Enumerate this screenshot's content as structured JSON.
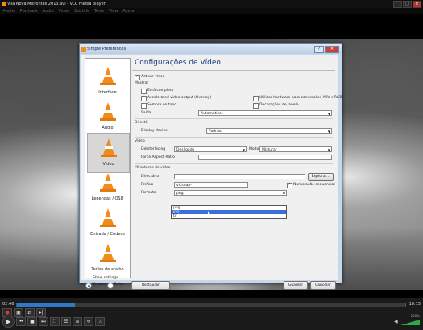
{
  "vlc": {
    "title": "Vila Nova Millfontes 2013.avi - VLC media player",
    "menu": [
      "Media",
      "Playback",
      "Audio",
      "Video",
      "Subtitle",
      "Tools",
      "View",
      "Ajuda"
    ],
    "time_current": "02:46",
    "time_total": "18:15",
    "progress": 0.15,
    "volume_label": "100%"
  },
  "prefs": {
    "title": "Simple Preferences",
    "panel_title": "Configurações de Vídeo",
    "categories": [
      "Interface",
      "Áudio",
      "Vídeo",
      "Legendas / OSD",
      "Entrada / Codecs",
      "Teclas de atalho"
    ],
    "selected_category": "Vídeo",
    "activate_video": "Activar vídeo",
    "show_section": "Mostrar",
    "fullscreen": "Ecrã completo",
    "accelerated": "Accelerated video output (Overlay)",
    "always_on_top": "Sempre no topo",
    "hw_decoding": "Utilizar hardware para conversões YUV->RGB",
    "window_decorations": "Decorações de janela",
    "output_label": "Saída",
    "output_value": "Automático",
    "directx_section": "DirectX",
    "display_device_label": "Display device",
    "display_device_value": "Padrão",
    "video_section": "Vídeo",
    "deinterlacing_label": "Deinterlacing",
    "deinterlacing_value": "Desligado",
    "mode_label": "Modo",
    "mode_value": "Misturar",
    "force_aspect_label": "Force Aspect Ratio",
    "snapshots_section": "Miniaturas de vídeo",
    "directory_label": "Directório",
    "browse_button": "Explorar...",
    "prefix_label": "Prefixo",
    "prefix_value": "vlcsnap-",
    "sequential_label": "Numeração sequencial",
    "format_label": "Formato",
    "format_value": "png",
    "format_options": [
      "png",
      "jpg",
      "tif"
    ],
    "show_settings": "Show settings",
    "simple": "Simples",
    "all": "Todos",
    "reset_button": "Restaurar Preferências",
    "save_button": "Guardar",
    "cancel_button": "Cancelar"
  }
}
